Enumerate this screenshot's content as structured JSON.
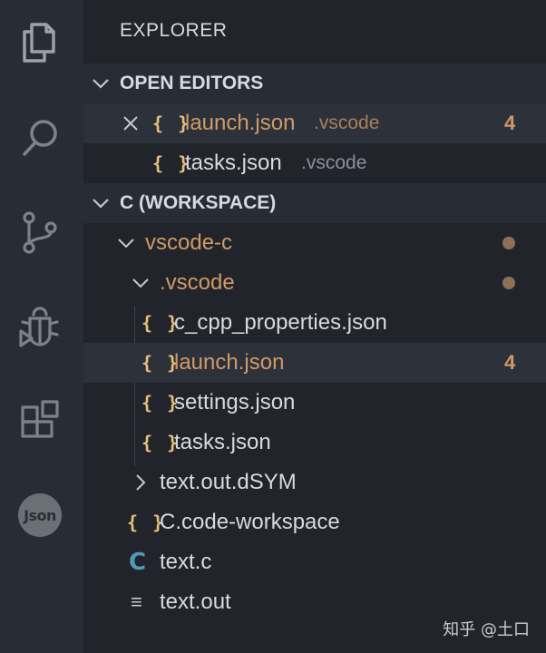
{
  "explorer_title": "EXPLORER",
  "open_editors": {
    "header": "OPEN EDITORS",
    "items": [
      {
        "icon": "{ }",
        "name": "launch.json",
        "desc": ".vscode",
        "badge": "4"
      },
      {
        "icon": "{ }",
        "name": "tasks.json",
        "desc": ".vscode"
      }
    ]
  },
  "workspace": {
    "header": "C (WORKSPACE)",
    "items": [
      {
        "name": "vscode-c"
      },
      {
        "name": ".vscode"
      },
      {
        "icon": "{ }",
        "name": "c_cpp_properties.json"
      },
      {
        "icon": "{ }",
        "name": "launch.json",
        "badge": "4"
      },
      {
        "icon": "{ }",
        "name": "settings.json"
      },
      {
        "icon": "{ }",
        "name": "tasks.json"
      },
      {
        "name": "text.out.dSYM"
      },
      {
        "icon": "{ }",
        "name": "C.code-workspace"
      },
      {
        "icon": "C",
        "name": "text.c"
      },
      {
        "icon": "≡",
        "name": "text.out"
      }
    ]
  },
  "activity_bar": {
    "json_badge": "Json"
  },
  "colors": {
    "modified": "#d19a66",
    "json_icon": "#e5c07b",
    "c_icon": "#519aba",
    "sidebar_bg": "#21252b",
    "selected_bg": "#2c313a"
  },
  "watermark": "知乎 @土口"
}
